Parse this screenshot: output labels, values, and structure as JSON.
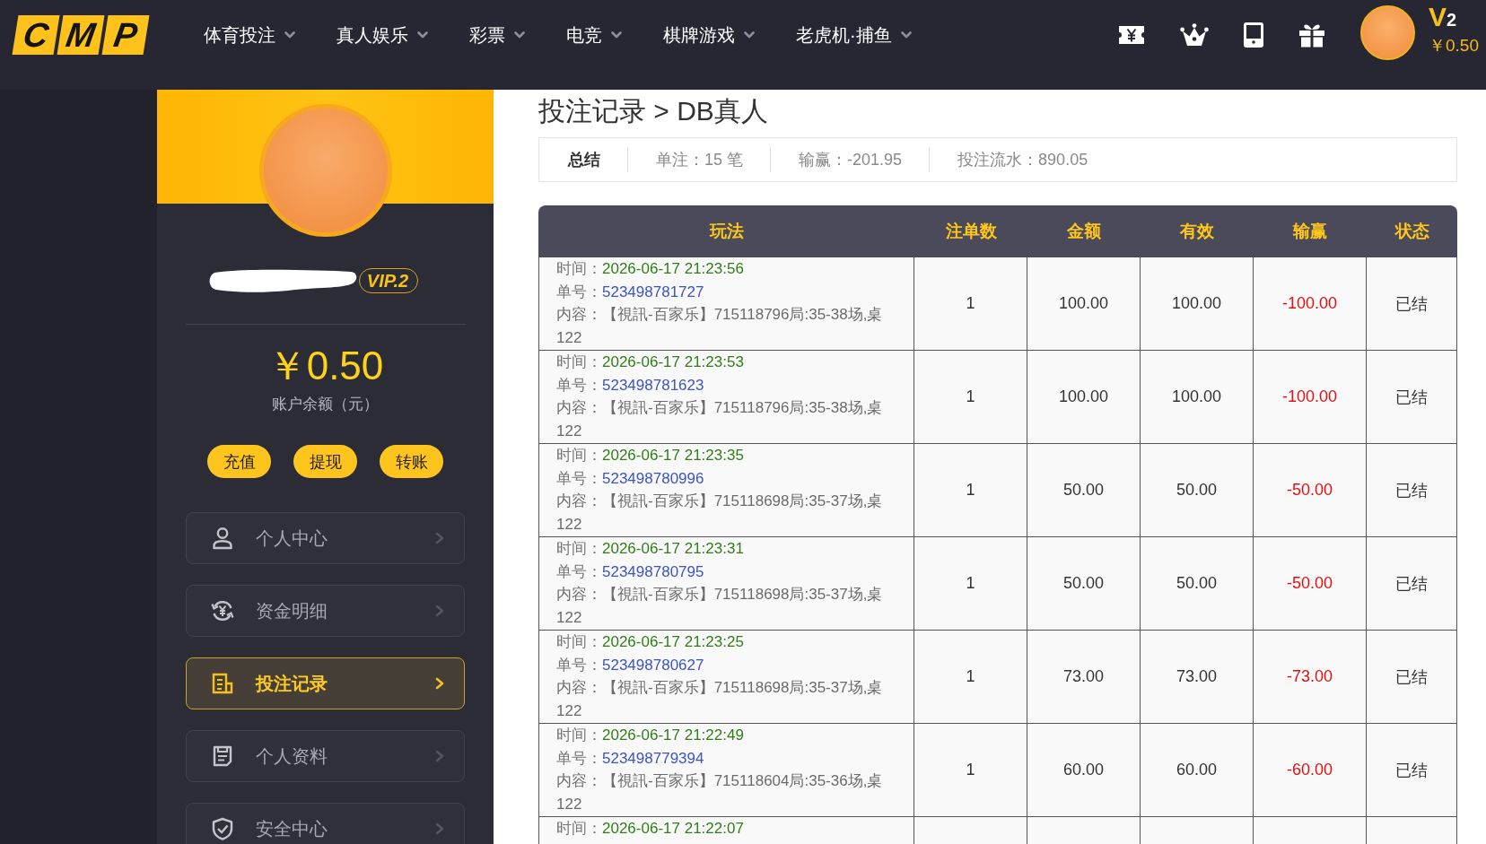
{
  "header": {
    "logo": [
      "C",
      "M",
      "P"
    ],
    "nav": [
      {
        "label": "体育投注"
      },
      {
        "label": "真人娱乐"
      },
      {
        "label": "彩票"
      },
      {
        "label": "电竞"
      },
      {
        "label": "棋牌游戏"
      },
      {
        "label": "老虎机·捕鱼"
      }
    ],
    "vip_mark": "V$_{2}$",
    "balance": "￥0.50"
  },
  "sidebar": {
    "vip_label": "VIP.2",
    "balance": "￥0.50",
    "balance_caption": "账户余额（元）",
    "actions": [
      "充值",
      "提现",
      "转账"
    ],
    "menu": [
      {
        "label": "个人中心",
        "selected": false
      },
      {
        "label": "资金明细",
        "selected": false
      },
      {
        "label": "投注记录",
        "selected": true
      },
      {
        "label": "个人资料",
        "selected": false
      },
      {
        "label": "安全中心",
        "selected": false
      }
    ]
  },
  "main": {
    "breadcrumb": "投注记录 > DB真人",
    "summary": [
      {
        "kind": "title",
        "text": "总结"
      },
      {
        "kind": "stat",
        "text": "单注：15 笔"
      },
      {
        "kind": "stat",
        "text": "输赢：-201.95"
      },
      {
        "kind": "stat",
        "text": "投注流水：890.05"
      }
    ],
    "table": {
      "columns": [
        "玩法",
        "注单数",
        "金额",
        "有效",
        "输赢",
        "状态"
      ],
      "rows": [
        {
          "time_label": "时间：",
          "time": "2026-06-17 21:23:56",
          "order_label": "单号：",
          "order_no": "523498781727",
          "content": "内容：【視訊-百家乐】715118796局:35-38场,桌122",
          "count": "1",
          "amount": "100.00",
          "valid": "100.00",
          "win_loss": "-100.00",
          "status": "已结"
        },
        {
          "time_label": "时间：",
          "time": "2026-06-17 21:23:53",
          "order_label": "单号：",
          "order_no": "523498781623",
          "content": "内容：【視訊-百家乐】715118796局:35-38场,桌122",
          "count": "1",
          "amount": "100.00",
          "valid": "100.00",
          "win_loss": "-100.00",
          "status": "已结"
        },
        {
          "time_label": "时间：",
          "time": "2026-06-17 21:23:35",
          "order_label": "单号：",
          "order_no": "523498780996",
          "content": "内容：【視訊-百家乐】715118698局:35-37场,桌122",
          "count": "1",
          "amount": "50.00",
          "valid": "50.00",
          "win_loss": "-50.00",
          "status": "已结"
        },
        {
          "time_label": "时间：",
          "time": "2026-06-17 21:23:31",
          "order_label": "单号：",
          "order_no": "523498780795",
          "content": "内容：【視訊-百家乐】715118698局:35-37场,桌122",
          "count": "1",
          "amount": "50.00",
          "valid": "50.00",
          "win_loss": "-50.00",
          "status": "已结"
        },
        {
          "time_label": "时间：",
          "time": "2026-06-17 21:23:25",
          "order_label": "单号：",
          "order_no": "523498780627",
          "content": "内容：【視訊-百家乐】715118698局:35-37场,桌122",
          "count": "1",
          "amount": "73.00",
          "valid": "73.00",
          "win_loss": "-73.00",
          "status": "已结"
        },
        {
          "time_label": "时间：",
          "time": "2026-06-17 21:22:49",
          "order_label": "单号：",
          "order_no": "523498779394",
          "content": "内容：【視訊-百家乐】715118604局:35-36场,桌122",
          "count": "1",
          "amount": "60.00",
          "valid": "60.00",
          "win_loss": "-60.00",
          "status": "已结"
        },
        {
          "time_label": "时间：",
          "time": "2026-06-17 21:22:07"
        }
      ]
    }
  }
}
